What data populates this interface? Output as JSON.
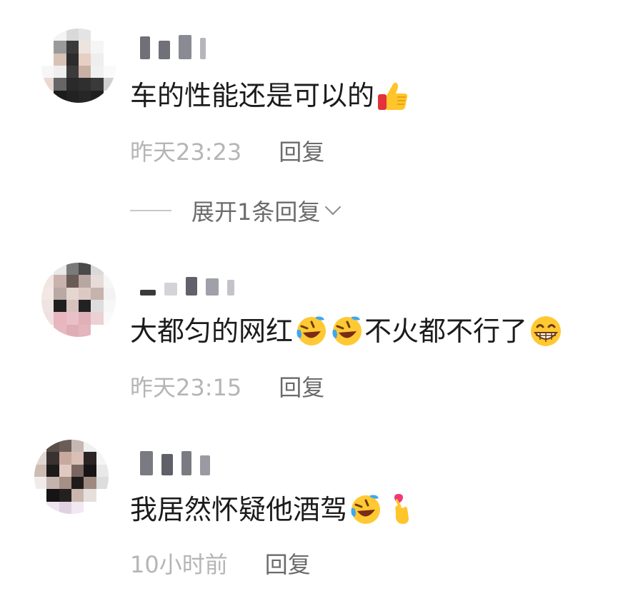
{
  "comments": [
    {
      "text": "车的性能还是可以的",
      "emojis": [
        "thumbs-up-emoji"
      ],
      "time": "昨天23:23",
      "reply_label": "回复",
      "expand_label": "展开1条回复"
    },
    {
      "text_part1": "大都匀的网红",
      "text_part2": "不火都不行了",
      "emojis": [
        "rofl-emoji",
        "rofl-emoji",
        "grinning-emoji"
      ],
      "time": "昨天23:15",
      "reply_label": "回复"
    },
    {
      "text": "我居然怀疑他酒驾",
      "emojis": [
        "rofl-emoji",
        "finger-heart-emoji"
      ],
      "time": "10小时前",
      "reply_label": "回复"
    }
  ]
}
